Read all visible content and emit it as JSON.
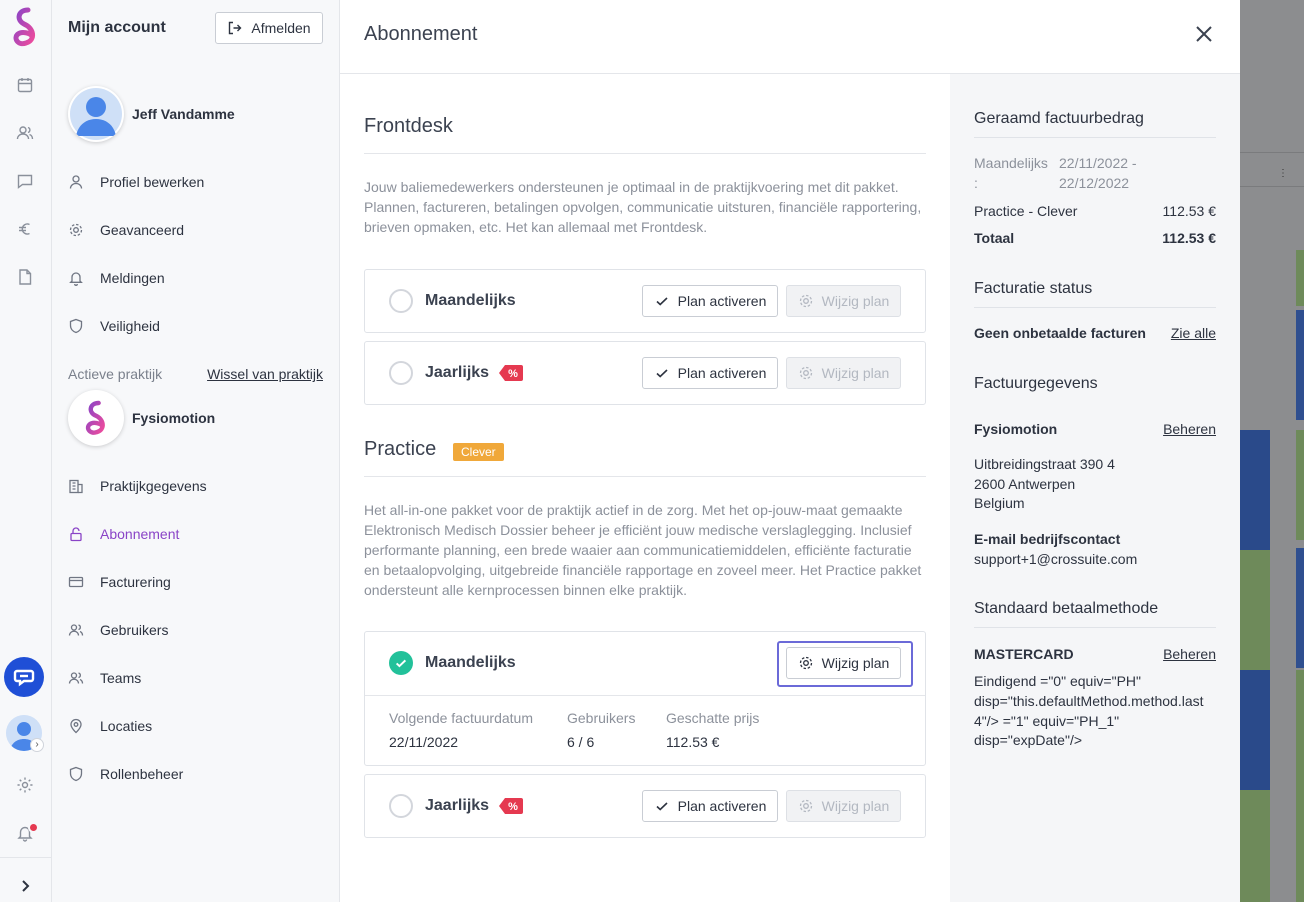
{
  "rail": {
    "icons": [
      "calendar-icon",
      "users-icon",
      "chat-icon",
      "euro-icon",
      "document-icon",
      "settings-icon",
      "bell-icon",
      "chevron-right-icon"
    ]
  },
  "account": {
    "title": "Mijn account",
    "logout_label": "Afmelden",
    "user_name": "Jeff Vandamme",
    "user_menu": [
      {
        "label": "Profiel bewerken",
        "icon": "person-icon"
      },
      {
        "label": "Geavanceerd",
        "icon": "gear-icon"
      },
      {
        "label": "Meldingen",
        "icon": "bell-icon"
      },
      {
        "label": "Veiligheid",
        "icon": "shield-icon"
      }
    ],
    "practice_label": "Actieve praktijk",
    "switch_label": "Wissel van praktijk",
    "practice_name": "Fysiomotion",
    "practice_menu": [
      {
        "label": "Praktijkgegevens",
        "icon": "building-icon"
      },
      {
        "label": "Abonnement",
        "icon": "lock-icon",
        "active": true
      },
      {
        "label": "Facturering",
        "icon": "card-icon"
      },
      {
        "label": "Gebruikers",
        "icon": "users-icon"
      },
      {
        "label": "Teams",
        "icon": "users-icon"
      },
      {
        "label": "Locaties",
        "icon": "location-icon"
      },
      {
        "label": "Rollenbeheer",
        "icon": "shield-icon"
      }
    ]
  },
  "modal": {
    "title": "Abonnement",
    "frontdesk": {
      "title": "Frontdesk",
      "description": "Jouw baliemedewerkers ondersteunen je optimaal in de praktijkvoering met dit pakket. Plannen, factureren, betalingen opvolgen, communicatie uitsturen, financiële rapportering, brieven opmaken, etc. Het kan allemaal met Frontdesk.",
      "plans": [
        {
          "name": "Maandelijks",
          "activate": "Plan activeren",
          "change": "Wijzig plan"
        },
        {
          "name": "Jaarlijks",
          "activate": "Plan activeren",
          "change": "Wijzig plan"
        }
      ]
    },
    "practice": {
      "title": "Practice",
      "badge": "Clever",
      "description": "Het all-in-one pakket voor de praktijk actief in de zorg. Met het op-jouw-maat gemaakte Elektronisch Medisch Dossier beheer je efficiënt jouw medische verslaglegging. Inclusief performante planning, een brede waaier aan communicatiemiddelen, efficiënte facturatie en betaalopvolging, uitgebreide financiële rapportage en zoveel meer. Het Practice pakket ondersteunt alle kernprocessen binnen elke praktijk.",
      "active_plan": {
        "name": "Maandelijks",
        "change": "Wijzig plan",
        "next_invoice_label": "Volgende factuurdatum",
        "next_invoice_value": "22/11/2022",
        "users_label": "Gebruikers",
        "users_value": "6 / 6",
        "price_label": "Geschatte prijs",
        "price_value": "112.53 €"
      },
      "yearly": {
        "name": "Jaarlijks",
        "activate": "Plan activeren",
        "change": "Wijzig plan"
      }
    }
  },
  "side": {
    "estimate_title": "Geraamd factuurbedrag",
    "period_label": "Maandelijks",
    "period_colon": ":",
    "period_from": "22/11/2022 -",
    "period_to": "22/12/2022",
    "line_label": "Practice - Clever",
    "line_value": "112.53 €",
    "total_label": "Totaal",
    "total_value": "112.53 €",
    "status_title": "Facturatie status",
    "status_text": "Geen onbetaalde facturen",
    "status_link": "Zie alle",
    "billing_title": "Factuurgegevens",
    "billing_name": "Fysiomotion",
    "billing_link": "Beheren",
    "address_line1": "Uitbreidingstraat 390 4",
    "address_line2": "2600 Antwerpen",
    "address_line3": "Belgium",
    "email_label": "E-mail bedrijfscontact",
    "email_value": "support+1@crossuite.com",
    "payment_title": "Standaard betaalmethode",
    "payment_card": "MASTERCARD",
    "payment_link": "Beheren",
    "payment_raw1": "Eindigend =\"0\" equiv=\"PH\"",
    "payment_raw2": "disp=\"this.defaultMethod.method.last",
    "payment_raw3": "4\"/> =\"1\" equiv=\"PH_1\"",
    "payment_raw4": "disp=\"expDate\"/>"
  },
  "colors": {
    "accent_purple": "#8a44c7",
    "success_green": "#22c19a",
    "badge_orange": "#f0a83a",
    "discount_red": "#e53950",
    "focus_ring": "#6b6ad8",
    "chat_blue": "#1f4fd6"
  }
}
